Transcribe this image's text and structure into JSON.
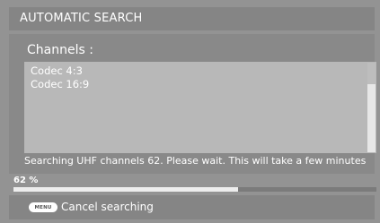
{
  "header": {
    "title": "AUTOMATIC SEARCH"
  },
  "channels": {
    "label": "Channels :",
    "items": [
      "Codec 4:3",
      "Codec 16:9"
    ]
  },
  "status": {
    "message": "Searching UHF channels 62. Please wait. This will take a few minutes"
  },
  "progress": {
    "label": "62 %",
    "fraction": 0.62
  },
  "footer": {
    "key_label": "MENU",
    "action_label": "Cancel searching"
  }
}
